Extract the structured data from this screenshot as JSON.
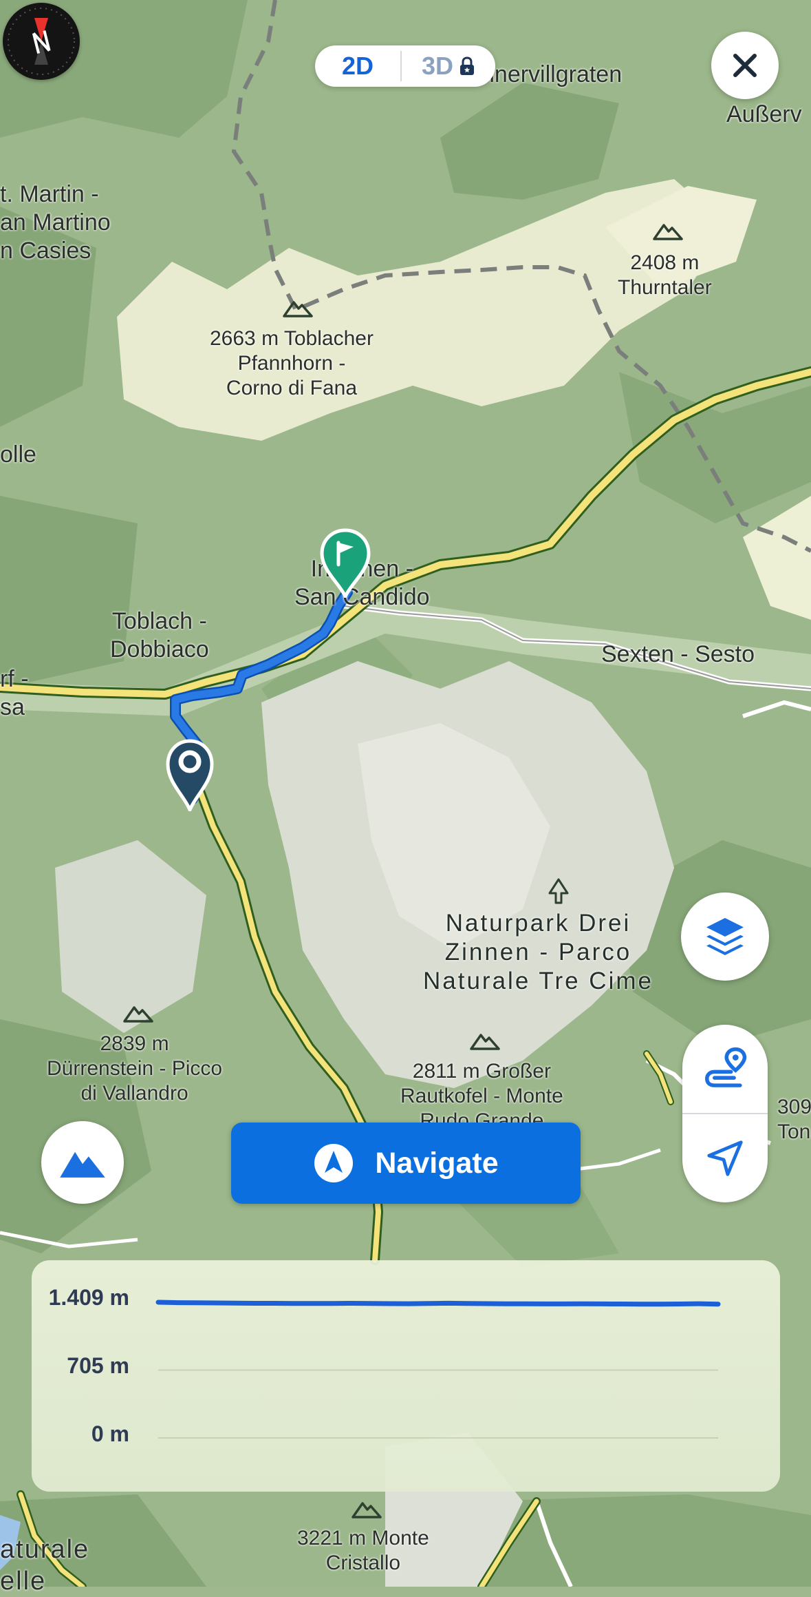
{
  "map": {
    "places": {
      "innervillgraten": "nnervillgraten",
      "ausserv": "Außerv",
      "st_martin": "t. Martin -\nan Martino\nn Casies",
      "olle": "olle",
      "innichen": "Innichen -\nSan Candido",
      "toblach": "Toblach -\nDobbiaco",
      "sexten": "Sexten - Sesto",
      "left_edge": "rf -\nsa",
      "park": "Naturpark Drei\nZinnen - Parco\nNaturale Tre Cime",
      "bottom_left": "aturale\nelle",
      "right_edge": "309\nTon"
    },
    "peaks": [
      {
        "label": "2663 m Toblacher\nPfannhorn -\nCorno di Fana"
      },
      {
        "label": "2408 m\nThurntaler"
      },
      {
        "label": "2839 m\nDürrenstein - Picco\ndi Vallandro"
      },
      {
        "label": "2811 m Großer\nRautkofel - Monte\nRudo Grande"
      },
      {
        "label": "3221 m Monte\nCristallo"
      }
    ],
    "colors": {
      "route": "#1c6fe0",
      "road": "#f4e27a",
      "start_pin": "#244a66",
      "end_pin": "#1aa37a"
    }
  },
  "toolbar": {
    "mode_2d": "2D",
    "mode_3d": "3D",
    "close_icon": "close-icon",
    "compass_icon": "compass-icon"
  },
  "controls": {
    "layers_icon": "layers-icon",
    "route_icon": "route-icon",
    "locate_icon": "locate-arrow-icon",
    "terrain_icon": "mountain-icon"
  },
  "navigate": {
    "label": "Navigate",
    "icon": "navigation-arrow-icon"
  },
  "elevation": {
    "ticks": [
      "1.409 m",
      "705 m",
      "0 m"
    ]
  },
  "chart_data": {
    "type": "line",
    "title": "",
    "xlabel": "",
    "ylabel": "",
    "ylim": [
      0,
      1409
    ],
    "series": [
      {
        "values": [
          1409,
          1405,
          1403,
          1402,
          1400,
          1398,
          1398,
          1397,
          1396,
          1397,
          1398,
          1396,
          1395,
          1394,
          1396,
          1399,
          1396,
          1395,
          1393,
          1393,
          1392,
          1392,
          1393,
          1392,
          1391,
          1390,
          1390,
          1391,
          1394,
          1390
        ]
      }
    ]
  }
}
